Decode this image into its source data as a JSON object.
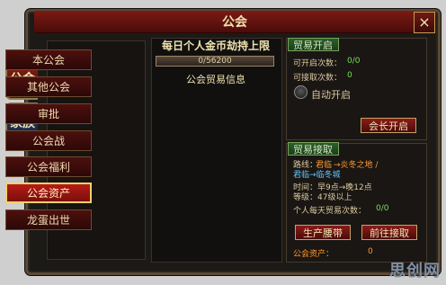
{
  "window": {
    "title": "公会",
    "close_label": "×"
  },
  "side_tabs": {
    "guild": "公会",
    "family": "家族"
  },
  "menu": {
    "items": [
      {
        "label": "本公会"
      },
      {
        "label": "其他公会"
      },
      {
        "label": "审批"
      },
      {
        "label": "公会战"
      },
      {
        "label": "公会福利"
      },
      {
        "label": "公会资产"
      },
      {
        "label": "龙蛋出世"
      }
    ]
  },
  "middle": {
    "title": "每日个人金币劫持上限",
    "progress_text": "0/56200",
    "subtitle": "公会贸易信息"
  },
  "trade_open": {
    "header": "贸易开启",
    "can_open_label": "可开启次数：",
    "can_open_value": "0/0",
    "can_receive_label": "可接取次数：",
    "can_receive_value": "0",
    "auto_label": "自动开启",
    "leader_button": "会长开启"
  },
  "trade_receive": {
    "header": "贸易接取",
    "route_label": "路线：",
    "route_line1_a": "君临",
    "route_line1_b": "→炎冬之地 /",
    "route_line2": "君临→临冬城",
    "time_line": "时间：早9点→晚12点",
    "level_line": "等级：47级以上",
    "daily_line": "个人每天贸易次数：",
    "daily_value": "0/0",
    "produce_button": "生产腰带",
    "goto_button": "前往接取",
    "asset_label": "公会资产：",
    "asset_value": "0"
  },
  "watermark": "思创网"
}
